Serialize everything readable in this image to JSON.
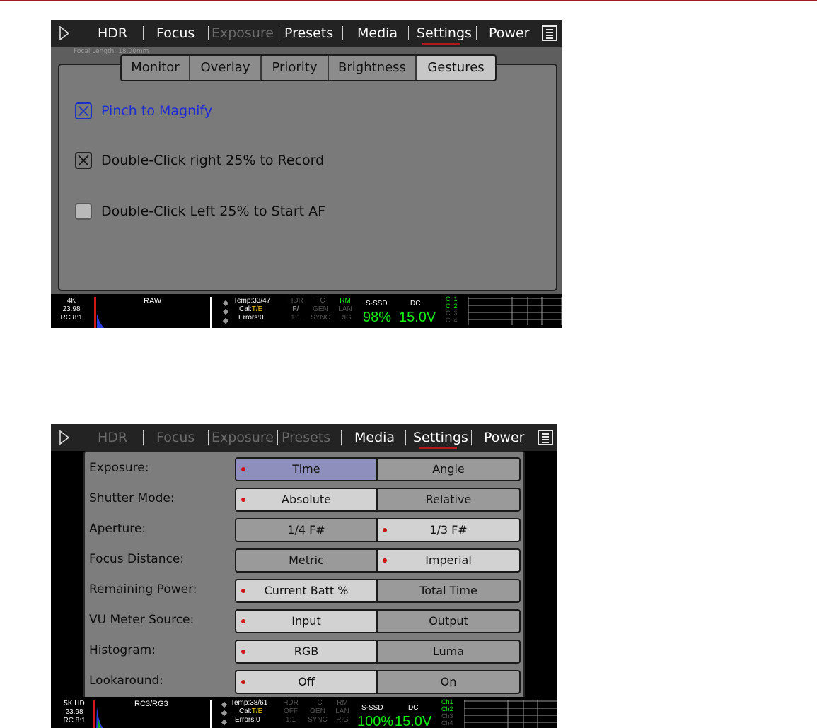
{
  "screen1": {
    "nav": {
      "items": [
        {
          "label": "HDR",
          "state": "enabled"
        },
        {
          "label": "Focus",
          "state": "enabled"
        },
        {
          "label": "Exposure",
          "state": "disabled"
        },
        {
          "label": "Presets",
          "state": "enabled"
        },
        {
          "label": "Media",
          "state": "enabled"
        },
        {
          "label": "Settings",
          "state": "active"
        },
        {
          "label": "Power",
          "state": "enabled"
        }
      ]
    },
    "background_text": "Focal Length: 18.00mm",
    "tabs": [
      {
        "label": "Monitor"
      },
      {
        "label": "Overlay"
      },
      {
        "label": "Priority"
      },
      {
        "label": "Brightness"
      },
      {
        "label": "Gestures",
        "active": true
      }
    ],
    "gestures": [
      {
        "label": "Pinch to Magnify",
        "checked": true,
        "focused": true
      },
      {
        "label": "Double-Click right 25% to Record",
        "checked": true,
        "focused": false
      },
      {
        "label": "Double-Click Left 25% to Start AF",
        "checked": false,
        "focused": false
      }
    ],
    "status": {
      "resolution": "4K",
      "fps": "23.98",
      "compression": "RC 8:1",
      "codec": "RAW",
      "temp": "Temp:33/47",
      "cal_prefix": "Cal:",
      "cal_value": "T/E",
      "errors": "Errors:0",
      "col_a": [
        "HDR",
        "F/",
        "1:1"
      ],
      "col_b": [
        "TC",
        "GEN",
        "SYNC"
      ],
      "col_c": [
        "RM",
        "LAN",
        "RIG"
      ],
      "media_label": "S-SSD",
      "media_value": "98%",
      "power_label": "DC",
      "power_value": "15.0V",
      "channels": [
        "Ch1",
        "Ch2",
        "Ch3",
        "Ch4"
      ]
    }
  },
  "screen2": {
    "nav": {
      "items": [
        {
          "label": "HDR",
          "state": "disabled"
        },
        {
          "label": "Focus",
          "state": "disabled"
        },
        {
          "label": "Exposure",
          "state": "disabled"
        },
        {
          "label": "Presets",
          "state": "disabled"
        },
        {
          "label": "Media",
          "state": "enabled"
        },
        {
          "label": "Settings",
          "state": "active"
        },
        {
          "label": "Power",
          "state": "enabled"
        }
      ]
    },
    "settings": [
      {
        "label": "Exposure:",
        "options": [
          "Time",
          "Angle"
        ],
        "selected": 0,
        "highlight": true
      },
      {
        "label": "Shutter Mode:",
        "options": [
          "Absolute",
          "Relative"
        ],
        "selected": 0
      },
      {
        "label": "Aperture:",
        "options": [
          "1/4 F#",
          "1/3 F#"
        ],
        "selected": 1
      },
      {
        "label": "Focus Distance:",
        "options": [
          "Metric",
          "Imperial"
        ],
        "selected": 1
      },
      {
        "label": "Remaining Power:",
        "options": [
          "Current Batt %",
          "Total Time"
        ],
        "selected": 0
      },
      {
        "label": "VU Meter Source:",
        "options": [
          "Input",
          "Output"
        ],
        "selected": 0
      },
      {
        "label": "Histogram:",
        "options": [
          "RGB",
          "Luma"
        ],
        "selected": 0
      },
      {
        "label": "Lookaround:",
        "options": [
          "Off",
          "On"
        ],
        "selected": 0
      }
    ],
    "status": {
      "resolution": "5K HD",
      "fps": "23.98",
      "compression": "RC 8:1",
      "codec": "RC3/RG3",
      "temp": "Temp:38/61",
      "cal_prefix": "Cal:",
      "cal_value": "T/E",
      "errors": "Errors:0",
      "col_a": [
        "HDR",
        "OFF",
        "1:1"
      ],
      "col_b": [
        "TC",
        "GEN",
        "SYNC"
      ],
      "col_c": [
        "RM",
        "LAN",
        "RIG"
      ],
      "media_label": "S-SSD",
      "media_value": "100%",
      "power_label": "DC",
      "power_value": "15.0V",
      "channels": [
        "Ch1",
        "Ch2",
        "Ch3",
        "Ch4"
      ]
    }
  },
  "colors": {
    "accent_red": "#b11a1a",
    "status_green": "#13f013",
    "status_yellow": "#e8d000",
    "focus_blue": "#1c2cd2",
    "selected_highlight": "#8f8fbd"
  }
}
